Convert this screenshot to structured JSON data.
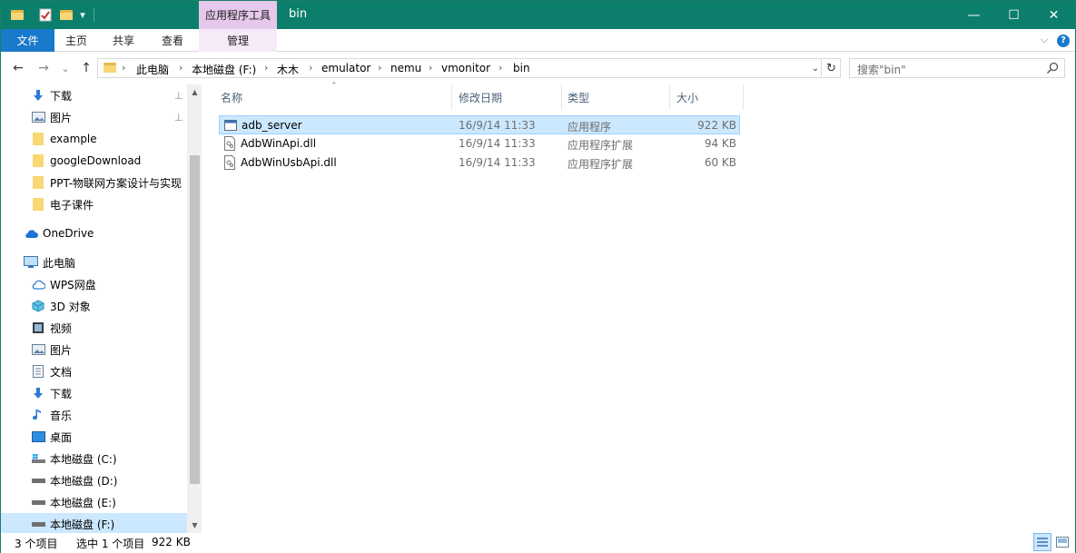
{
  "titlebar": {
    "context_tab": "应用程序工具",
    "title": "bin",
    "minimize_glyph": "—",
    "maximize_glyph": "☐",
    "close_glyph": "✕",
    "dropdown_glyph": "▾"
  },
  "ribbon": {
    "tabs": [
      "文件",
      "主页",
      "共享",
      "查看",
      "管理"
    ],
    "expand_glyph": "⌵",
    "help_glyph": "?"
  },
  "nav": {
    "back_glyph": "←",
    "forward_glyph": "→",
    "recent_glyph": "⌄",
    "up_glyph": "↑",
    "breadcrumb": [
      "此电脑",
      "本地磁盘 (F:)",
      "木木",
      "emulator",
      "nemu",
      "vmonitor",
      "bin"
    ],
    "sep_glyph": "›",
    "addr_dropdown_glyph": "⌄",
    "refresh_glyph": "↻",
    "search_placeholder": "搜索\"bin\""
  },
  "sidebar": {
    "items": [
      {
        "label": "下载",
        "icon": "download-arrow-icon",
        "pinned": true
      },
      {
        "label": "图片",
        "icon": "pictures-icon",
        "pinned": true
      },
      {
        "label": "example",
        "icon": "folder-icon"
      },
      {
        "label": "googleDownload",
        "icon": "folder-icon"
      },
      {
        "label": "PPT-物联网方案设计与实现",
        "icon": "folder-icon"
      },
      {
        "label": "电子课件",
        "icon": "folder-icon"
      },
      {
        "label": "OneDrive",
        "icon": "cloud-icon"
      },
      {
        "label": "此电脑",
        "icon": "computer-icon"
      },
      {
        "label": "WPS网盘",
        "icon": "cloud-outline-icon"
      },
      {
        "label": "3D 对象",
        "icon": "cube-icon"
      },
      {
        "label": "视频",
        "icon": "video-icon"
      },
      {
        "label": "图片",
        "icon": "pictures-icon"
      },
      {
        "label": "文档",
        "icon": "document-icon"
      },
      {
        "label": "下载",
        "icon": "download-arrow-icon"
      },
      {
        "label": "音乐",
        "icon": "music-note-icon"
      },
      {
        "label": "桌面",
        "icon": "desktop-icon"
      },
      {
        "label": "本地磁盘 (C:)",
        "icon": "windows-drive-icon"
      },
      {
        "label": "本地磁盘 (D:)",
        "icon": "drive-icon"
      },
      {
        "label": "本地磁盘 (E:)",
        "icon": "drive-icon"
      },
      {
        "label": "本地磁盘 (F:)",
        "icon": "drive-icon",
        "selected": true
      }
    ],
    "pin_glyph": "📌",
    "scroll_up_glyph": "▲",
    "scroll_down_glyph": "▼"
  },
  "file_list": {
    "columns": [
      "名称",
      "修改日期",
      "类型",
      "大小"
    ],
    "sort_glyph": "⌃",
    "rows": [
      {
        "name": "adb_server",
        "date": "16/9/14 11:33",
        "type": "应用程序",
        "size": "922 KB",
        "icon": "exe-icon",
        "selected": true
      },
      {
        "name": "AdbWinApi.dll",
        "date": "16/9/14 11:33",
        "type": "应用程序扩展",
        "size": "94 KB",
        "icon": "dll-icon"
      },
      {
        "name": "AdbWinUsbApi.dll",
        "date": "16/9/14 11:33",
        "type": "应用程序扩展",
        "size": "60 KB",
        "icon": "dll-icon"
      }
    ]
  },
  "status": {
    "count": "3 个项目",
    "selection": "选中 1 个项目",
    "size": "922 KB"
  },
  "colors": {
    "titlebar": "#0c7f6c",
    "file_tab": "#1979ca",
    "context_tab": "#e5c8ec",
    "selection": "#cce8ff"
  }
}
